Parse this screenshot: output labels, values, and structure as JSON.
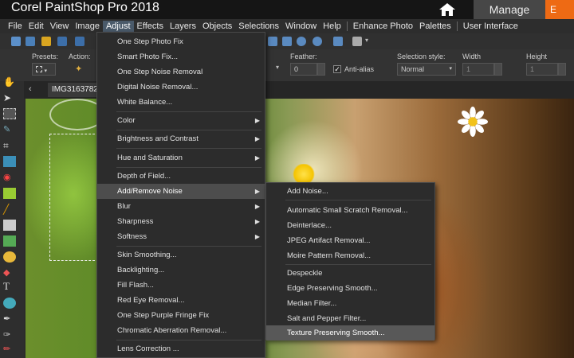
{
  "app": {
    "title": "Corel PaintShop Pro 2018",
    "manage_label": "Manage",
    "accent_tab_label": "E"
  },
  "menubar": [
    "File",
    "Edit",
    "View",
    "Image",
    "Adjust",
    "Effects",
    "Layers",
    "Objects",
    "Selections",
    "Window",
    "Help",
    "Enhance Photo",
    "Palettes",
    "User Interface"
  ],
  "options": {
    "presets_label": "Presets:",
    "action_label": "Action:",
    "feather_label": "Feather:",
    "feather_value": "0",
    "anti_alias_label": "Anti-alias",
    "anti_alias_checked": true,
    "selection_style_label": "Selection style:",
    "selection_style_value": "Normal",
    "width_label": "Width",
    "width_value": "1",
    "height_label": "Height",
    "height_value": "1"
  },
  "document": {
    "tab_label": "IMG3163782"
  },
  "adjust_menu": [
    {
      "label": "One Step Photo Fix",
      "submenu": false
    },
    {
      "label": "Smart Photo Fix...",
      "submenu": false
    },
    {
      "label": "One Step Noise Removal",
      "submenu": false
    },
    {
      "label": "Digital Noise Removal...",
      "submenu": false
    },
    {
      "label": "White Balance...",
      "submenu": false
    },
    {
      "label": "Color",
      "submenu": true
    },
    {
      "label": "Brightness and Contrast",
      "submenu": true
    },
    {
      "label": "Hue and Saturation",
      "submenu": true
    },
    {
      "label": "Depth of Field...",
      "submenu": false
    },
    {
      "label": "Add/Remove Noise",
      "submenu": true,
      "highlighted": true
    },
    {
      "label": "Blur",
      "submenu": true
    },
    {
      "label": "Sharpness",
      "submenu": true
    },
    {
      "label": "Softness",
      "submenu": true
    },
    {
      "label": "Skin Smoothing...",
      "submenu": false
    },
    {
      "label": "Backlighting...",
      "submenu": false
    },
    {
      "label": "Fill Flash...",
      "submenu": false
    },
    {
      "label": "Red Eye Removal...",
      "submenu": false
    },
    {
      "label": "One Step Purple Fringe Fix",
      "submenu": false
    },
    {
      "label": "Chromatic Aberration Removal...",
      "submenu": false
    },
    {
      "label": "Lens Correction ...",
      "submenu": false
    }
  ],
  "noise_submenu": [
    {
      "label": "Add Noise..."
    },
    {
      "label": "Automatic Small Scratch Removal..."
    },
    {
      "label": "Deinterlace..."
    },
    {
      "label": "JPEG Artifact Removal..."
    },
    {
      "label": "Moire Pattern Removal..."
    },
    {
      "label": "Despeckle"
    },
    {
      "label": "Edge Preserving Smooth..."
    },
    {
      "label": "Median Filter..."
    },
    {
      "label": "Salt and Pepper Filter..."
    },
    {
      "label": "Texture Preserving Smooth...",
      "highlighted": true
    }
  ],
  "colors": {
    "accent": "#ee6a14",
    "menu_bg": "#2c2c2c",
    "highlight": "#4d4d4d"
  }
}
